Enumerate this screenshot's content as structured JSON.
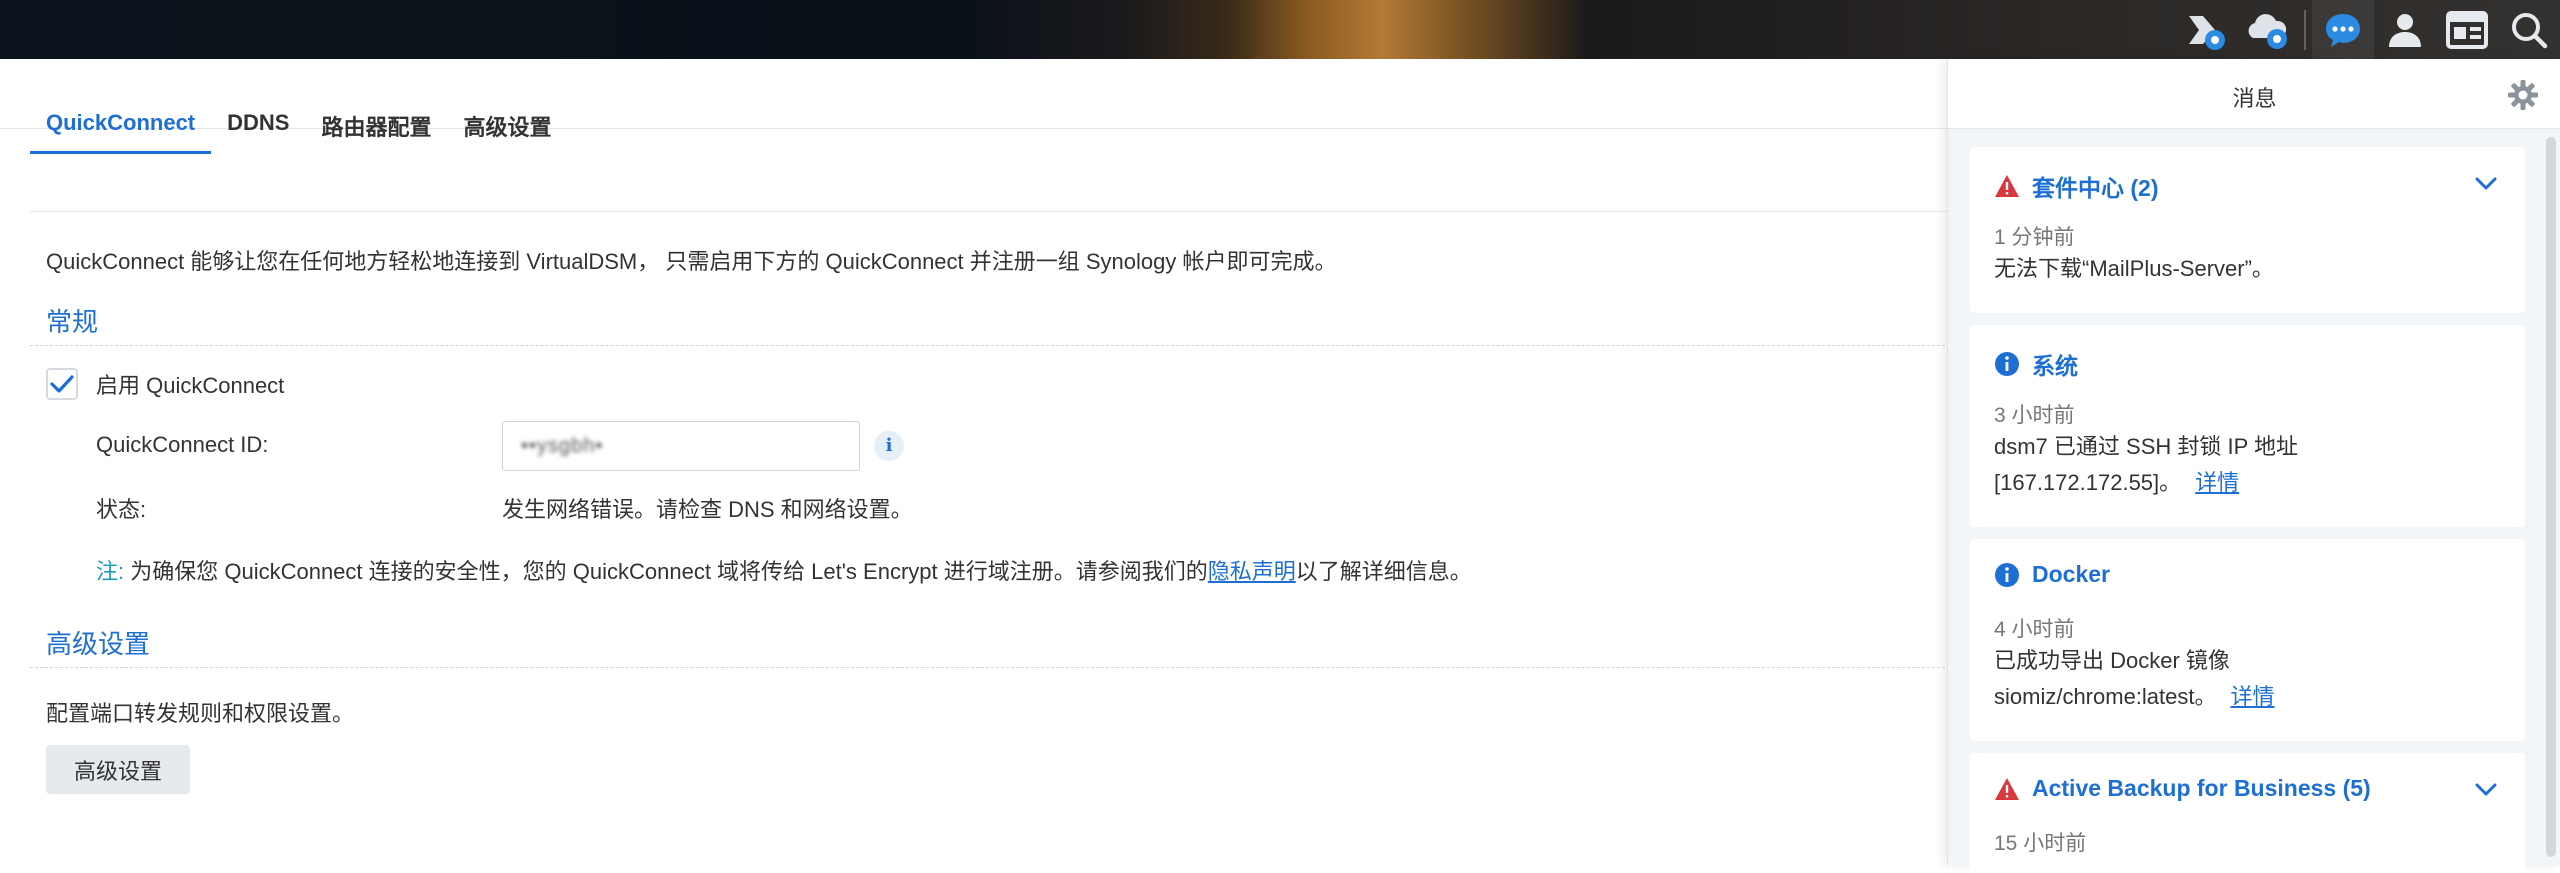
{
  "taskbar": {
    "icons": [
      "package-center-icon",
      "cloud-sync-icon",
      "notifications-icon",
      "user-icon",
      "widgets-icon",
      "search-icon"
    ]
  },
  "tabs": [
    {
      "label": "QuickConnect",
      "active": true
    },
    {
      "label": "DDNS",
      "active": false
    },
    {
      "label": "路由器配置",
      "active": false
    },
    {
      "label": "高级设置",
      "active": false
    }
  ],
  "main": {
    "description": "QuickConnect 能够让您在任何地方轻松地连接到 VirtualDSM， 只需启用下方的 QuickConnect 并注册一组 Synology 帐户即可完成。",
    "general_title": "常规",
    "enable_label": "启用 QuickConnect",
    "enable_checked": true,
    "id_label": "QuickConnect ID:",
    "id_value": "••ysgbh•",
    "status_label": "状态:",
    "status_value": "发生网络错误。请检查 DNS 和网络设置。",
    "note_prefix": "注:",
    "note_text": " 为确保您 QuickConnect 连接的安全性，您的 QuickConnect 域将传给 Let's Encrypt 进行域注册。请参阅我们的",
    "note_link": "隐私声明",
    "note_suffix": "以了解详细信息。",
    "advanced_title": "高级设置",
    "advanced_desc": "配置端口转发规则和权限设置。",
    "advanced_button": "高级设置"
  },
  "notifications": {
    "title": "消息",
    "items": [
      {
        "icon": "warning-icon",
        "title": "套件中心 (2)",
        "time": "1 分钟前",
        "body": "无法下载“MailPlus-Server”。",
        "link": "",
        "expandable": true
      },
      {
        "icon": "info-icon",
        "title": "系统",
        "time": "3 小时前",
        "body_line1": "dsm7 已通过 SSH 封锁 IP 地址",
        "body_line2": "[167.172.172.55]。",
        "link": "详情",
        "expandable": false
      },
      {
        "icon": "info-icon",
        "title": "Docker",
        "time": "4 小时前",
        "body_line1": "已成功导出 Docker 镜像",
        "body_line2": "siomiz/chrome:latest。",
        "link": "详情",
        "expandable": false
      },
      {
        "icon": "warning-icon",
        "title": "Active Backup for Business (5)",
        "time": "15 小时前",
        "expandable": true
      }
    ]
  },
  "colors": {
    "accent": "#1e6fd4",
    "warning": "#d9363e",
    "note": "#1f9bb8"
  }
}
